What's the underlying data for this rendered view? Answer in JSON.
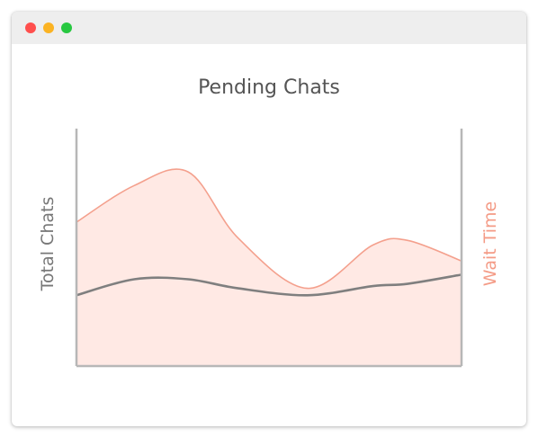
{
  "window": {
    "buttons": [
      "close",
      "minimize",
      "maximize"
    ]
  },
  "chart_data": {
    "type": "area",
    "title": "Pending Chats",
    "ylabel_left": "Total Chats",
    "ylabel_right": "Wait Time",
    "x": [
      0,
      0.15,
      0.29,
      0.42,
      0.6,
      0.77,
      0.86,
      1.0
    ],
    "xlim": [
      0,
      1
    ],
    "ylim": [
      0,
      1
    ],
    "series": [
      {
        "name": "Wait Time",
        "axis": "right",
        "type": "area",
        "values": [
          0.63,
          0.79,
          0.85,
          0.56,
          0.34,
          0.53,
          0.55,
          0.46
        ]
      },
      {
        "name": "Total Chats",
        "axis": "left",
        "type": "line",
        "values": [
          0.31,
          0.38,
          0.38,
          0.34,
          0.31,
          0.35,
          0.36,
          0.4
        ]
      }
    ],
    "colors": {
      "wait_line": "#f4a08d",
      "wait_fill": "#ffe9e4",
      "total_line": "#7f7f7f",
      "axis": "#b7b7b7"
    },
    "grid": false,
    "legend": "none"
  }
}
